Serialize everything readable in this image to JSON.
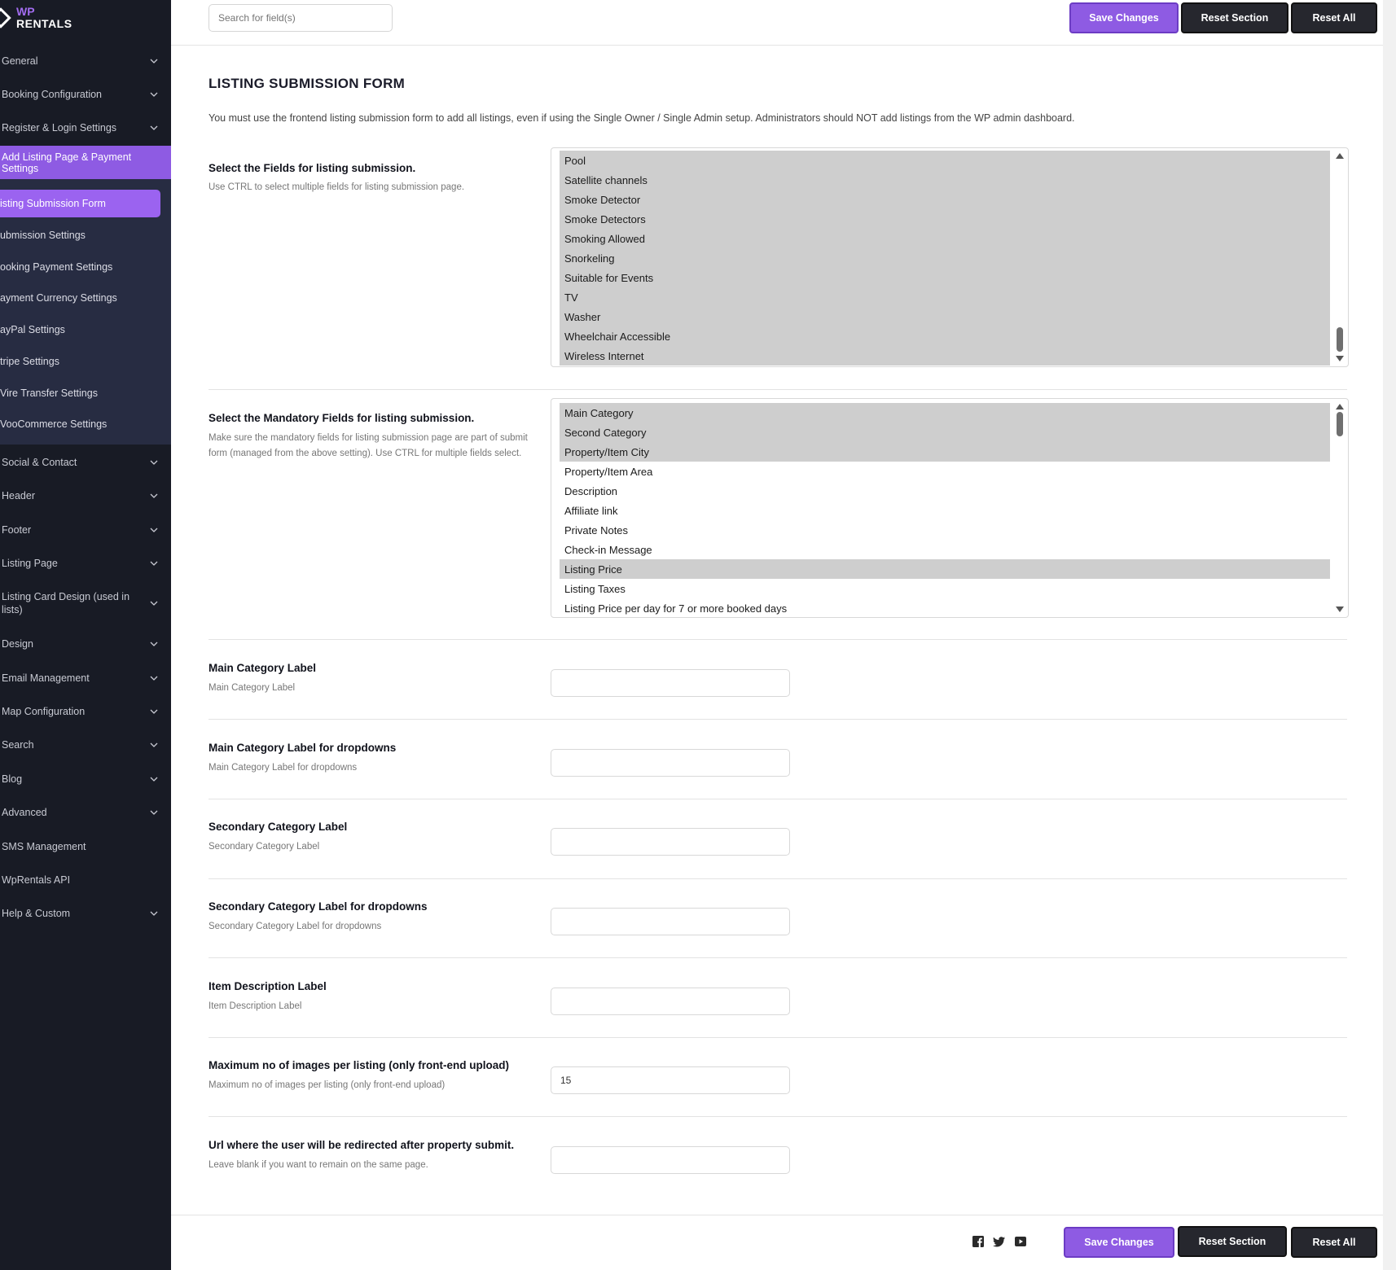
{
  "brand": {
    "line1": "WP",
    "line2": "RENTALS"
  },
  "sidebar": {
    "items": [
      {
        "label": "General"
      },
      {
        "label": "Booking Configuration"
      },
      {
        "label": "Register & Login Settings"
      },
      {
        "label": "Add Listing Page & Payment Settings"
      },
      {
        "label": "Social & Contact"
      },
      {
        "label": "Header"
      },
      {
        "label": "Footer"
      },
      {
        "label": "Listing Page"
      },
      {
        "label": "Listing Card Design (used in lists)"
      },
      {
        "label": "Design"
      },
      {
        "label": "Email Management"
      },
      {
        "label": "Map Configuration"
      },
      {
        "label": "Search"
      },
      {
        "label": "Blog"
      },
      {
        "label": "Advanced"
      },
      {
        "label": "SMS Management"
      },
      {
        "label": "WpRentals API"
      },
      {
        "label": "Help & Custom"
      }
    ],
    "subitems": [
      {
        "label": "isting Submission Form"
      },
      {
        "label": "ubmission Settings"
      },
      {
        "label": "ooking Payment Settings"
      },
      {
        "label": "ayment Currency Settings"
      },
      {
        "label": "ayPal Settings"
      },
      {
        "label": "tripe Settings"
      },
      {
        "label": "Vire Transfer Settings"
      },
      {
        "label": "VooCommerce Settings"
      }
    ]
  },
  "toolbar": {
    "search_placeholder": "Search for field(s)",
    "save_label": "Save Changes",
    "reset_section_label": "Reset Section",
    "reset_all_label": "Reset All"
  },
  "page": {
    "title": "LISTING SUBMISSION FORM",
    "description": "You must use the frontend listing submission form to add all listings, even if using the Single Owner / Single Admin setup. Administrators should NOT add listings from the WP admin dashboard."
  },
  "fields_select": {
    "label": "Select the Fields for listing submission.",
    "hint": "Use CTRL to select multiple fields for listing submission page.",
    "options": [
      {
        "text": "Pool",
        "selected": true
      },
      {
        "text": "Satellite channels",
        "selected": true
      },
      {
        "text": "Smoke Detector",
        "selected": true
      },
      {
        "text": "Smoke Detectors",
        "selected": true
      },
      {
        "text": "Smoking Allowed",
        "selected": true
      },
      {
        "text": "Snorkeling",
        "selected": true
      },
      {
        "text": "Suitable for Events",
        "selected": true
      },
      {
        "text": "TV",
        "selected": true
      },
      {
        "text": "Washer",
        "selected": true
      },
      {
        "text": "Wheelchair Accessible",
        "selected": true
      },
      {
        "text": "Wireless Internet",
        "selected": true
      }
    ]
  },
  "mandatory_select": {
    "label": "Select the Mandatory Fields for listing submission.",
    "hint": "Make sure the mandatory fields for listing submission page are part of submit form (managed from the above setting). Use CTRL for multiple fields select.",
    "options": [
      {
        "text": "Main Category",
        "selected": true
      },
      {
        "text": "Second Category",
        "selected": true
      },
      {
        "text": "Property/Item City",
        "selected": true
      },
      {
        "text": "Property/Item Area",
        "selected": false
      },
      {
        "text": "Description",
        "selected": false
      },
      {
        "text": "Affiliate link",
        "selected": false
      },
      {
        "text": "Private Notes",
        "selected": false
      },
      {
        "text": "Check-in Message",
        "selected": false
      },
      {
        "text": "Listing Price",
        "selected": true
      },
      {
        "text": "Listing Taxes",
        "selected": false
      },
      {
        "text": "Listing Price per day for 7 or more booked days",
        "selected": false
      }
    ]
  },
  "settings": [
    {
      "label": "Main Category Label",
      "hint": "Main Category Label",
      "value": ""
    },
    {
      "label": "Main Category Label for dropdowns",
      "hint": "Main Category Label for dropdowns",
      "value": ""
    },
    {
      "label": "Secondary Category Label",
      "hint": "Secondary Category Label",
      "value": ""
    },
    {
      "label": "Secondary Category Label for dropdowns",
      "hint": "Secondary Category Label for dropdowns",
      "value": ""
    },
    {
      "label": "Item Description Label",
      "hint": "Item Description Label",
      "value": ""
    },
    {
      "label": "Maximum no of images per listing (only front-end upload)",
      "hint": "Maximum no of images per listing (only front-end upload)",
      "value": "15"
    },
    {
      "label": "Url where the user will be redirected after property submit.",
      "hint": "Leave blank if you want to remain on the same page.",
      "value": ""
    }
  ],
  "footer": {
    "social_icons": [
      "facebook-icon",
      "twitter-icon",
      "youtube-icon"
    ]
  },
  "colors": {
    "accent": "#8e5be3",
    "sidebar": "#181b25",
    "submenu": "#272c42",
    "dark_button": "#26272e"
  }
}
